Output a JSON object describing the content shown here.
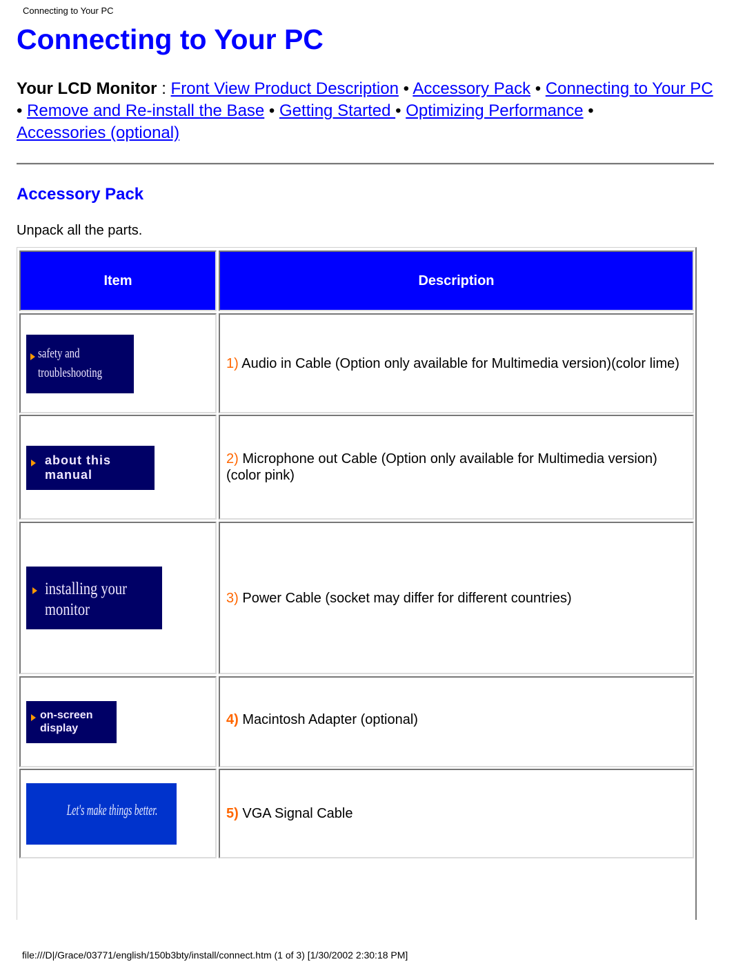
{
  "running_header": "Connecting to Your PC",
  "page_title": "Connecting to Your PC",
  "nav": {
    "lead": "Your LCD Monitor",
    "separator_colon": " : ",
    "bullet": " • ",
    "links": [
      {
        "label": "Front View Product Description"
      },
      {
        "label": "Accessory Pack"
      },
      {
        "label": "Connecting to Your PC"
      },
      {
        "label": "Remove and Re-install the Base"
      },
      {
        "label": "Getting Started "
      },
      {
        "label": "Optimizing Performance"
      },
      {
        "label": "Accessories (optional)"
      }
    ]
  },
  "section": {
    "title": "Accessory Pack",
    "intro": "Unpack all the parts."
  },
  "table": {
    "header_color": "#0000ff",
    "number_color": "#ff6600",
    "columns": [
      "Item",
      "Description"
    ],
    "rows": [
      {
        "number": "1)",
        "text": " Audio in Cable (Option only available for Multimedia version)(color lime)",
        "image_label": [
          "safety and",
          "troubleshooting"
        ]
      },
      {
        "number": "2)",
        "text": " Microphone out Cable (Option only available for Multimedia version)(color pink)",
        "image_label": [
          "about this",
          "manual"
        ]
      },
      {
        "number": "3)",
        "text": " Power Cable (socket may differ for different countries)",
        "image_label": [
          "installing your",
          "monitor"
        ]
      },
      {
        "number": "4)",
        "text": " Macintosh Adapter (optional)",
        "image_label": [
          "on-screen",
          "display"
        ]
      },
      {
        "number": "5)",
        "text": " VGA Signal Cable",
        "image_label": [
          "Let's make things better."
        ]
      }
    ]
  },
  "footer": "file:///D|/Grace/03771/english/150b3bty/install/connect.htm (1 of 3) [1/30/2002 2:30:18 PM]"
}
